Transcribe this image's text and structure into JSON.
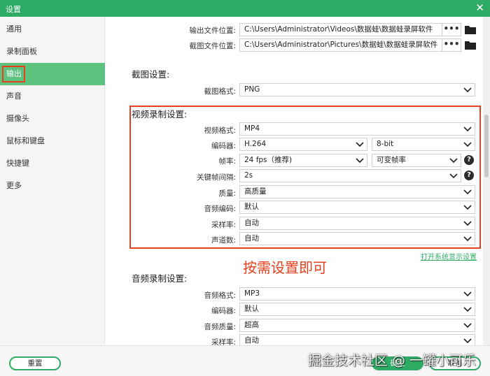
{
  "window": {
    "title": "设置",
    "close_glyph": "✕"
  },
  "sidebar": {
    "items": [
      {
        "label": "通用"
      },
      {
        "label": "录制面板"
      },
      {
        "label": "输出"
      },
      {
        "label": "声音"
      },
      {
        "label": "摄像头"
      },
      {
        "label": "鼠标和键盘"
      },
      {
        "label": "快捷键"
      },
      {
        "label": "更多"
      }
    ],
    "active_index": 2
  },
  "output": {
    "output_folder_label": "输出文件位置:",
    "output_folder_value": "C:\\Users\\Administrator\\Videos\\数据蛙\\数据蛙录屏软件",
    "screenshot_folder_label": "截图文件位置:",
    "screenshot_folder_value": "C:\\Users\\Administrator\\Pictures\\数据蛙\\数据蛙录屏软件",
    "browse_glyph": "•••"
  },
  "screenshot_settings": {
    "heading": "截图设置:",
    "format_label": "截图格式:",
    "format_value": "PNG"
  },
  "video_settings": {
    "heading": "视频录制设置:",
    "format_label": "视频格式:",
    "format_value": "MP4",
    "encoder_label": "编码器:",
    "encoder_value": "H.264",
    "bitdepth_value": "8-bit",
    "framerate_label": "帧率:",
    "framerate_value": "24 fps（推荐)",
    "framerate_mode_value": "可变帧率",
    "keyframe_label": "关键帧间隔:",
    "keyframe_value": "2s",
    "quality_label": "质量:",
    "quality_value": "高质量",
    "audio_codec_label": "音频编码:",
    "audio_codec_value": "默认",
    "samplerate_label": "采样率:",
    "samplerate_value": "自动",
    "channels_label": "声道数:",
    "channels_value": "自动"
  },
  "annotation": "按需设置即可",
  "open_display_settings_link": "打开系统显示设置",
  "audio_settings": {
    "heading": "音频录制设置:",
    "format_label": "音频格式:",
    "format_value": "MP3",
    "encoder_label": "编码器:",
    "encoder_value": "默认",
    "quality_label": "音频质量:",
    "quality_value": "超高",
    "samplerate_label": "采样率:",
    "samplerate_value": "自动"
  },
  "footer": {
    "reset_label": "重置",
    "ok_label": "确定",
    "cancel_label": "取消"
  },
  "watermark": "掘金技术社区 @ 一罐小可乐",
  "help_glyph": "?",
  "colors": {
    "accent": "#2eac66",
    "sidebar_active": "#5cc27e",
    "highlight": "#e8401e"
  }
}
